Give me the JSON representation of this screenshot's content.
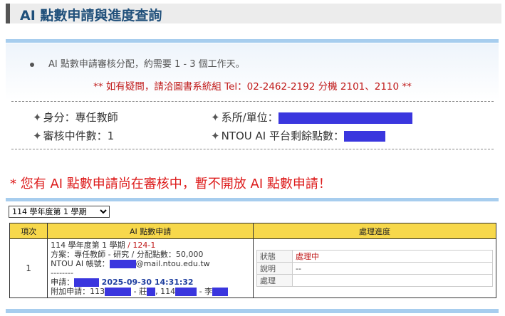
{
  "page": {
    "title": "AI 點數申請與進度查詢"
  },
  "notice": {
    "bullet": "AI 點數申請審核分配，約需要 1 - 3 個工作天。",
    "contact": "** 如有疑問，請洽圖書系統組 Tel：02-2462-2192 分機 2101、2110 **"
  },
  "info": {
    "star": "✦",
    "identity_label": "身分：",
    "identity_value": "專任教師",
    "department_label": "系所/單位：",
    "pending_label": "審核中件數：",
    "pending_value": "1",
    "remaining_label": "NTOU AI 平台剩餘點數："
  },
  "warning": "* 您有 AI 點數申請尚在審核中，暫不開放 AI 點數申請！",
  "semester_select": {
    "selected": "114 學年度第 1 學期"
  },
  "table": {
    "headers": [
      "項次",
      "AI 點數申請",
      "處理進度"
    ],
    "row": {
      "index": "1",
      "semester": "114 學年度第 1 學期",
      "slash": " / ",
      "app_id": "124-1",
      "plan": "方案：專任教師 - 研究 / 分配點數：50,000",
      "account_label": "NTOU AI 帳號：",
      "account_domain": "@mail.ntou.edu.tw",
      "divider": "--------",
      "apply_label": "申請：",
      "apply_time": "2025-09-30 14:31:32",
      "extra_prefix": "附加申請：113",
      "extra_mid1": " - 莊",
      "extra_mid2": ", 114",
      "extra_mid3": " - 李",
      "status_label": "狀態",
      "status_value": "處理中",
      "note_label": "說明",
      "note_value": "--",
      "handle_label": "處理",
      "handle_value": ""
    }
  },
  "colors": {
    "title": "#1f4f7a",
    "accent_line": "#a7cdee",
    "warning": "#dd1b1b",
    "header_bg": "#f7d84b",
    "redaction": "#3a36de"
  }
}
